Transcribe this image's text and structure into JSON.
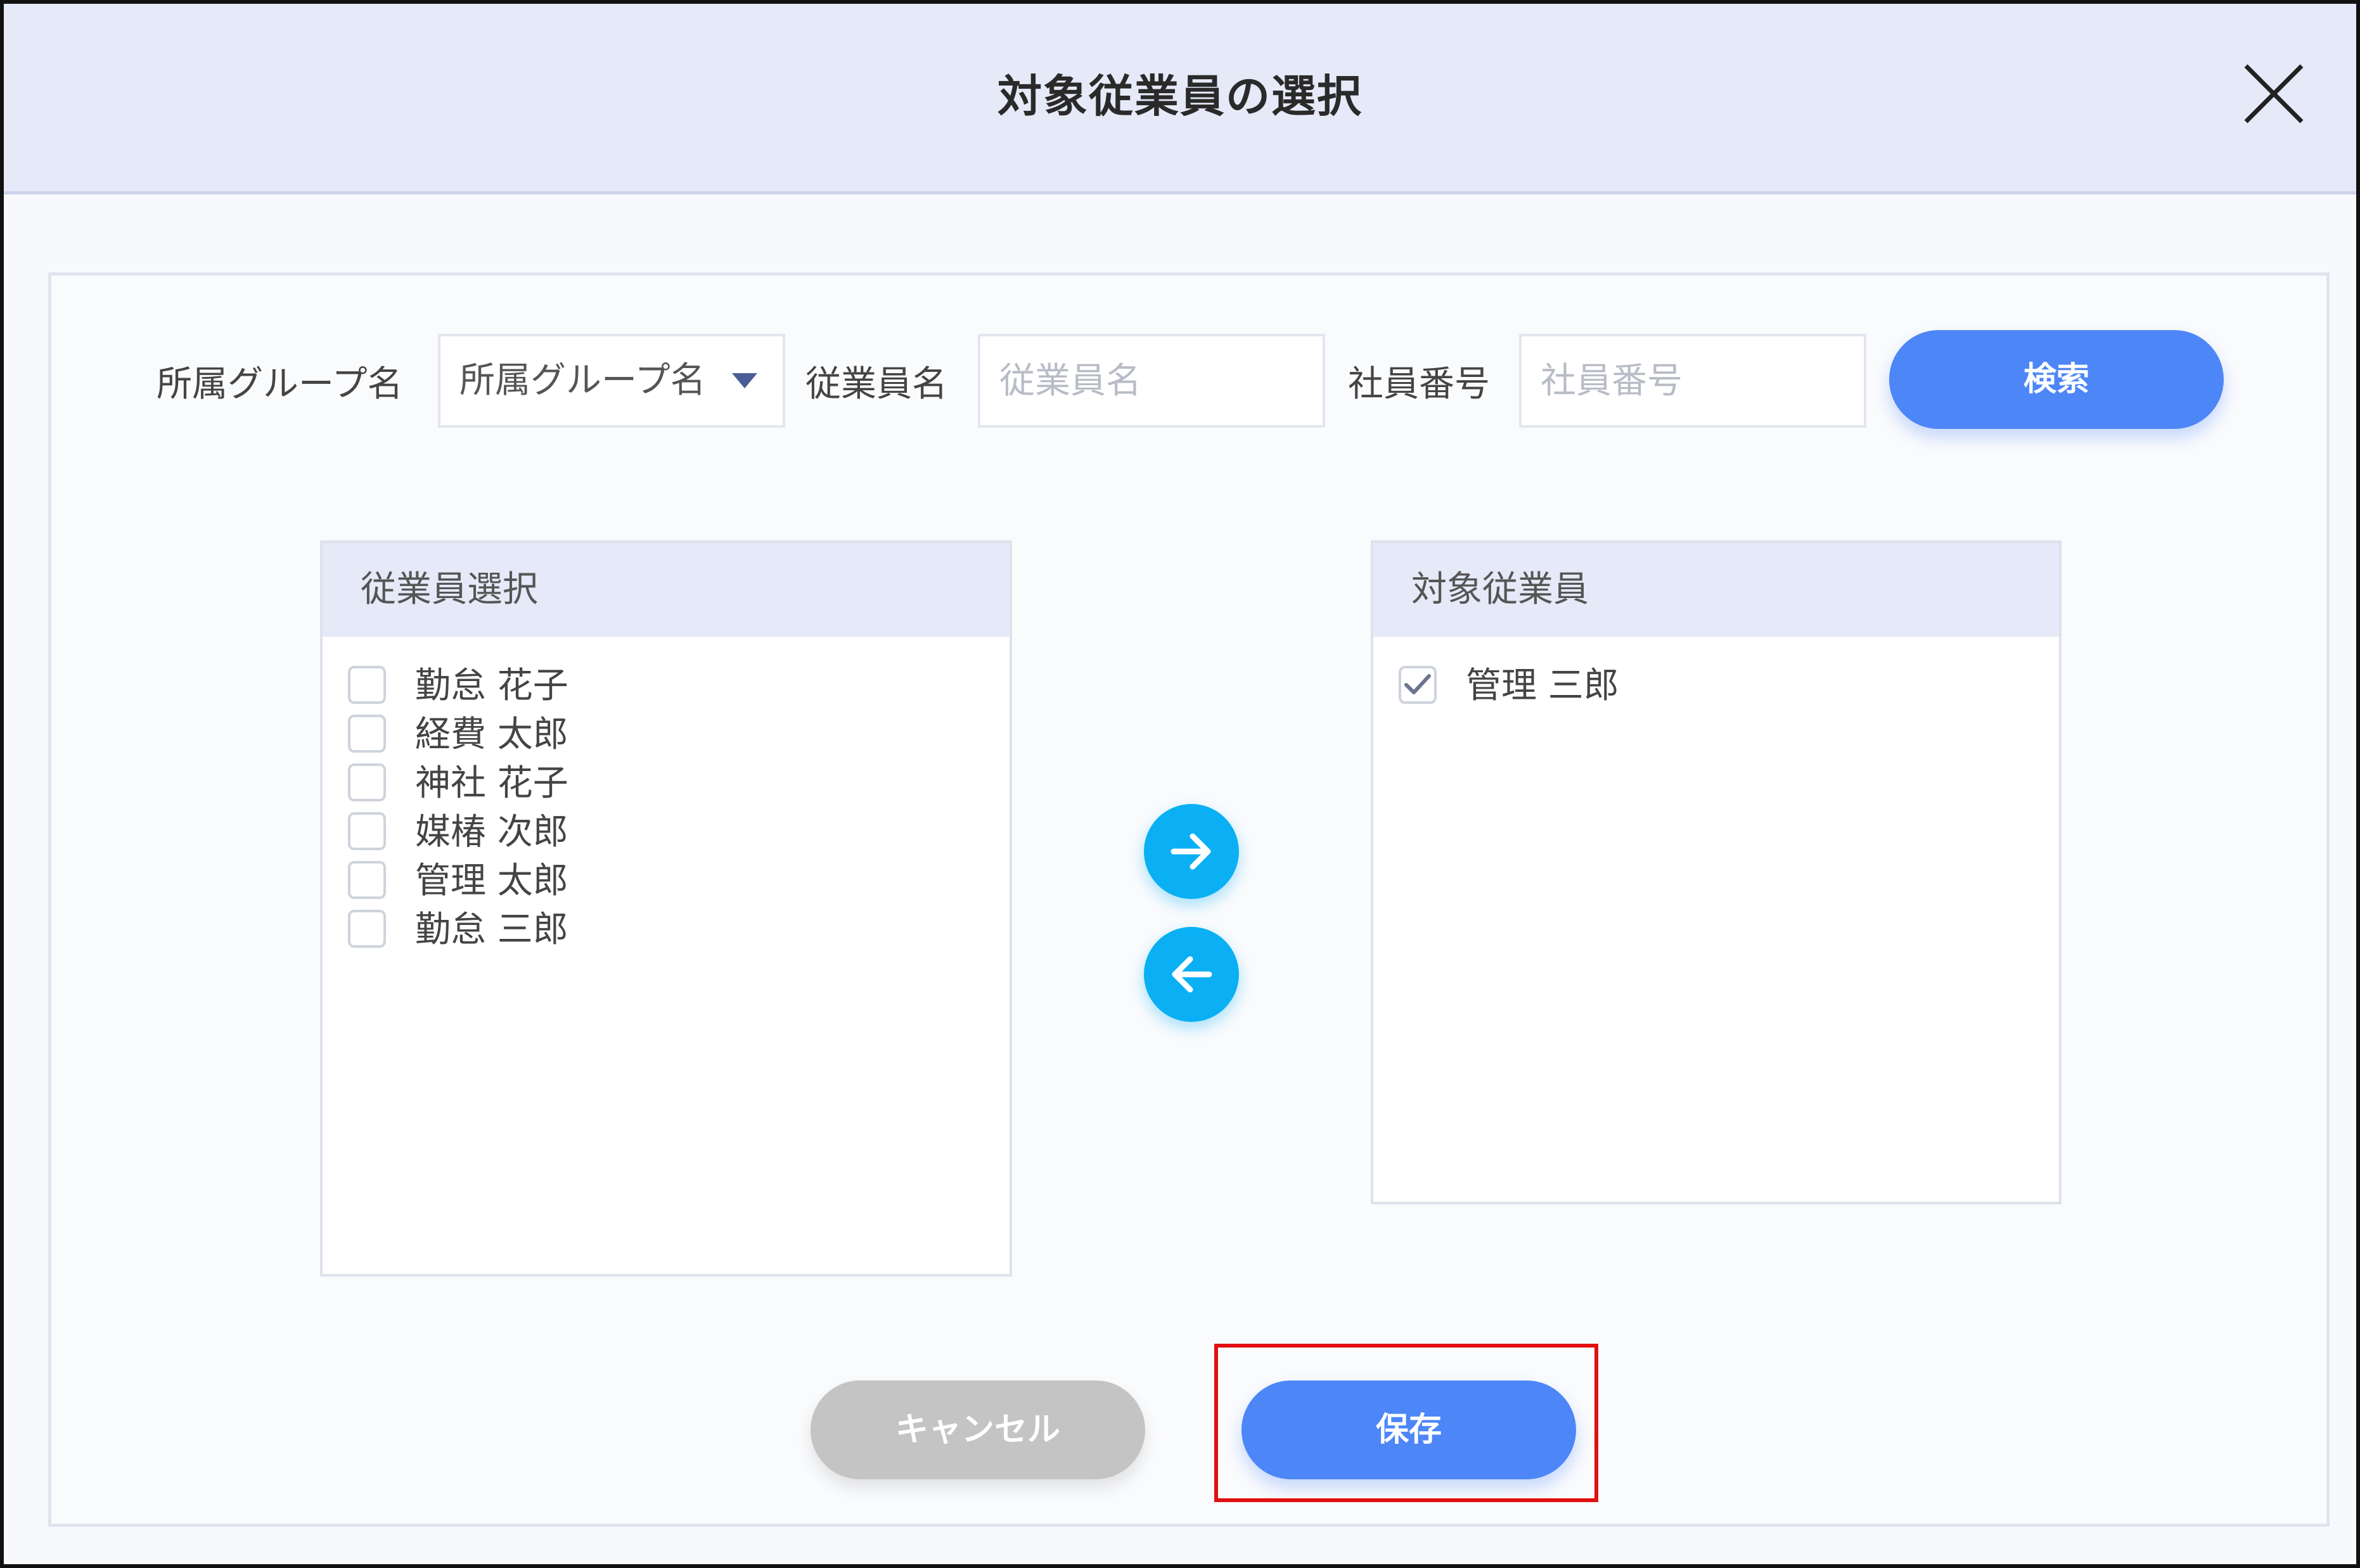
{
  "dialog": {
    "title": "対象従業員の選択",
    "close_icon": "close-icon"
  },
  "search": {
    "group_label": "所属グループ名",
    "group_select_value": "所属グループ名",
    "name_label": "従業員名",
    "name_placeholder": "従業員名",
    "number_label": "社員番号",
    "number_placeholder": "社員番号",
    "search_button": "検索"
  },
  "employee_list": {
    "header": "従業員選択",
    "items": [
      {
        "name": "勤怠 花子",
        "checked": false
      },
      {
        "name": "経費 太郎",
        "checked": false
      },
      {
        "name": "神社 花子",
        "checked": false
      },
      {
        "name": "媒椿 次郎",
        "checked": false
      },
      {
        "name": "管理 太郎",
        "checked": false
      },
      {
        "name": "勤怠 三郎",
        "checked": false
      }
    ]
  },
  "target_list": {
    "header": "対象従業員",
    "items": [
      {
        "name": "管理 三郎",
        "checked": true
      }
    ]
  },
  "transfer": {
    "add_icon": "arrow-right-icon",
    "remove_icon": "arrow-left-icon"
  },
  "footer": {
    "cancel_label": "キャンセル",
    "save_label": "保存"
  },
  "colors": {
    "primary": "#4d86f7",
    "transfer": "#0ab0f3",
    "cancel": "#c4c4c4",
    "header_bg": "#e6e9f7",
    "highlight": "#e01010"
  }
}
